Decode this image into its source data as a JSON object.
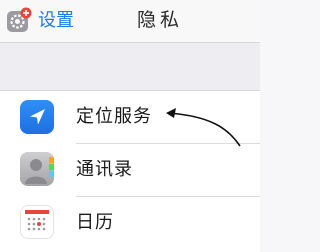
{
  "nav": {
    "back_label": "设置",
    "back_icon": "settings-gear-icon",
    "title": "隐私"
  },
  "rows": [
    {
      "label": "定位服务",
      "icon": "location-arrow-icon"
    },
    {
      "label": "通讯录",
      "icon": "contacts-icon"
    },
    {
      "label": "日历",
      "icon": "calendar-icon"
    }
  ],
  "colors": {
    "accent": "#1f7bf2",
    "location_icon": "#2f8ff6",
    "calendar_accent": "#e8463a"
  },
  "annotation": "pointer-arrow"
}
